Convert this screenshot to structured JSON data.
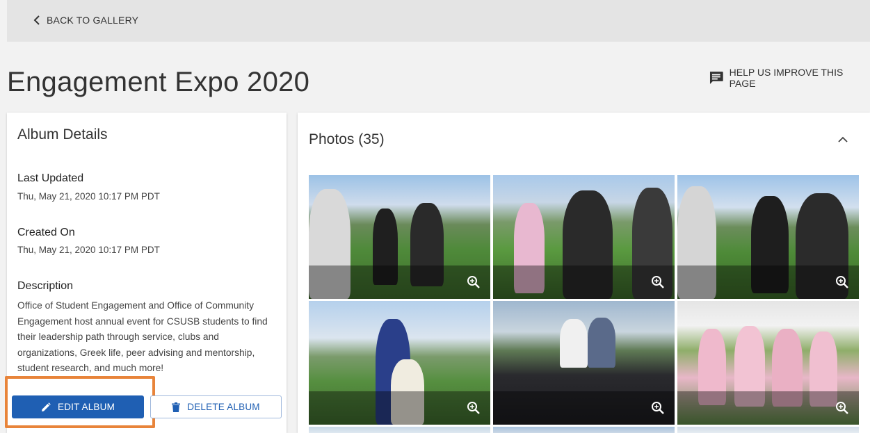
{
  "nav": {
    "back_label": "BACK TO GALLERY"
  },
  "page": {
    "title": "Engagement Expo 2020",
    "help_label": "HELP US IMPROVE THIS PAGE"
  },
  "album": {
    "heading": "Album Details",
    "last_updated_label": "Last Updated",
    "last_updated_value": "Thu, May 21, 2020 10:17 PM PDT",
    "created_label": "Created On",
    "created_value": "Thu, May 21, 2020 10:17 PM PDT",
    "description_label": "Description",
    "description": "Office of Student Engagement and Office of Community Engagement host annual event for CSUSB students to find their leadership path through service, clubs and organizations, Greek life, peer advising and mentorship, student research, and much more!",
    "edit_label": "EDIT ALBUM",
    "delete_label": "DELETE ALBUM"
  },
  "photos": {
    "heading": "Photos (35)"
  },
  "colors": {
    "primary": "#1f5fb3",
    "highlight": "#e8843a",
    "background": "#f2f2f2"
  },
  "icons": {
    "back": "chevron-left-icon",
    "help": "feedback-icon",
    "edit": "pencil-icon",
    "delete": "trash-icon",
    "collapse": "chevron-up-icon",
    "zoom": "zoom-in-icon"
  }
}
